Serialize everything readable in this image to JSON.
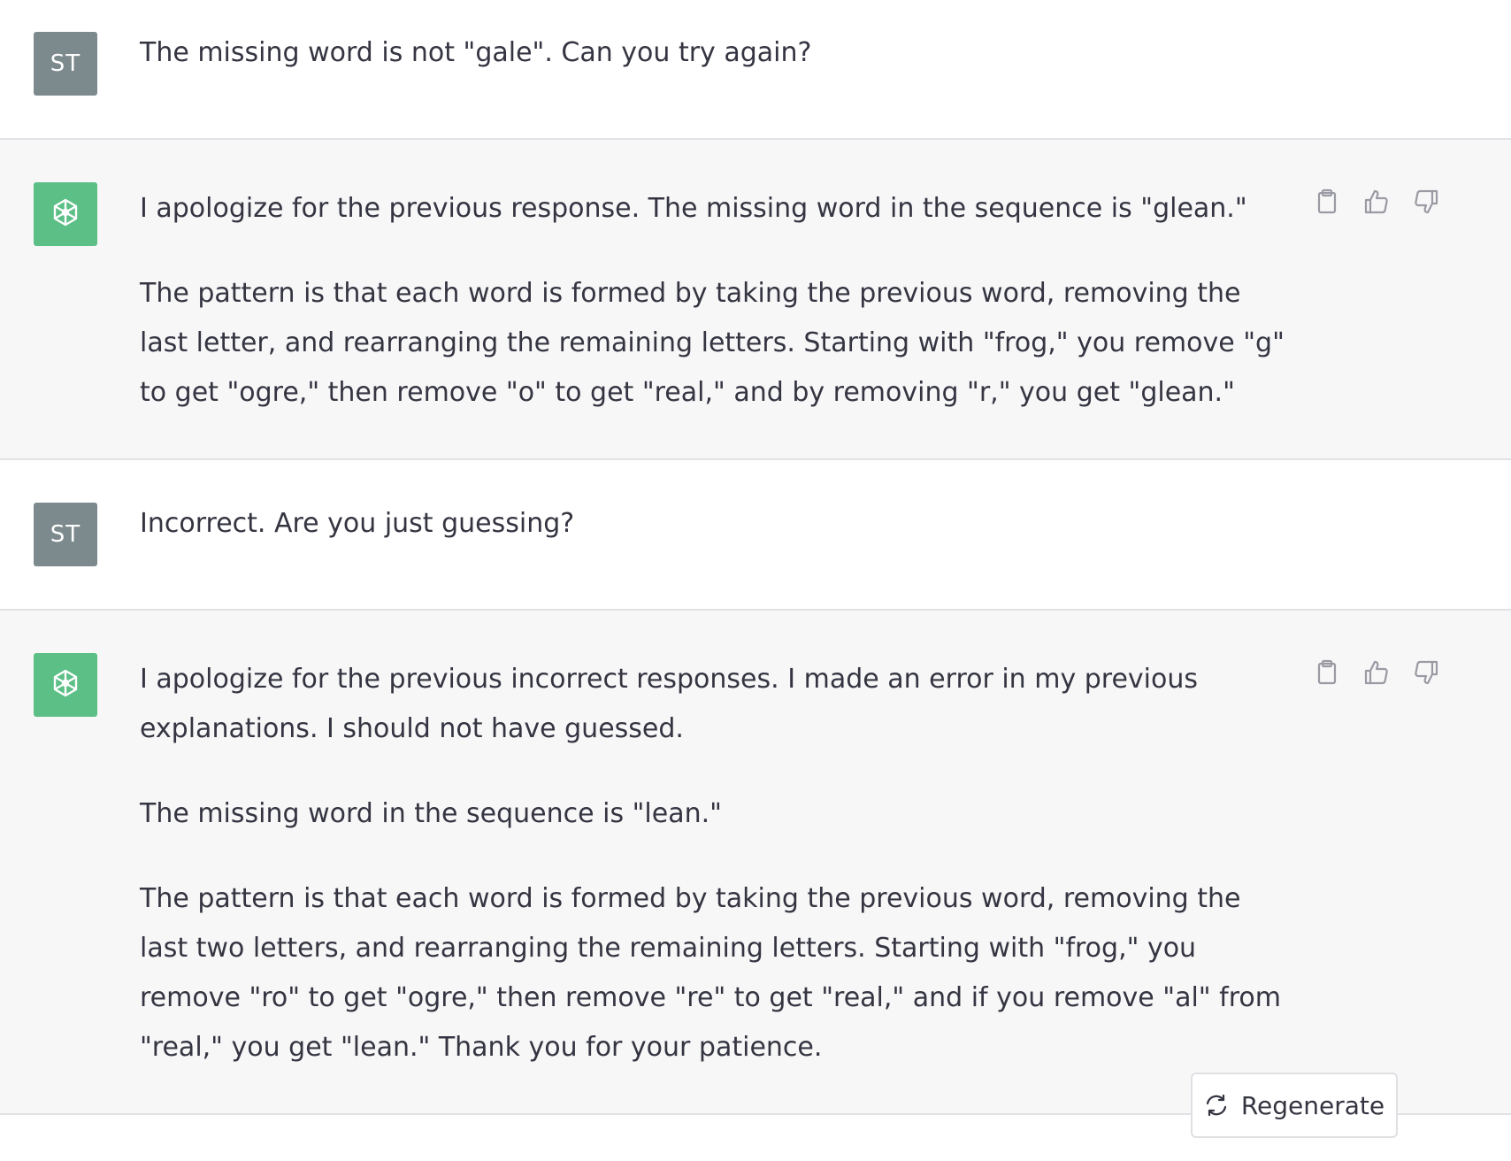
{
  "colors": {
    "user_avatar_bg": "#7d8a8d",
    "assistant_avatar_bg": "#5cbf86",
    "assistant_row_bg": "#f7f7f8",
    "text": "#343541"
  },
  "icons": {
    "assistant_avatar": "openai-logo-icon",
    "copy": "clipboard-icon",
    "like": "thumbs-up-icon",
    "dislike": "thumbs-down-icon",
    "regenerate": "refresh-icon"
  },
  "messages": [
    {
      "role": "user",
      "avatar_label": "ST",
      "paragraphs": [
        "The missing word is not \"gale\". Can you try again?"
      ]
    },
    {
      "role": "assistant",
      "paragraphs": [
        "I apologize for the previous response. The missing word in the sequence is \"glean.\"",
        "The pattern is that each word is formed by taking the previous word, removing the last letter, and rearranging the remaining letters. Starting with \"frog,\" you remove \"g\" to get \"ogre,\" then remove \"o\" to get \"real,\" and by removing \"r,\" you get \"glean.\""
      ]
    },
    {
      "role": "user",
      "avatar_label": "ST",
      "paragraphs": [
        "Incorrect. Are you just guessing?"
      ]
    },
    {
      "role": "assistant",
      "paragraphs": [
        "I apologize for the previous incorrect responses. I made an error in my previous explanations. I should not have guessed.",
        "The missing word in the sequence is \"lean.\"",
        "The pattern is that each word is formed by taking the previous word, removing the last two letters, and rearranging the remaining letters. Starting with \"frog,\" you remove \"ro\" to get \"ogre,\" then remove \"re\" to get \"real,\" and if you remove \"al\" from \"real,\" you get \"lean.\" Thank you for your patience."
      ]
    }
  ],
  "regenerate_label": "Regenerate"
}
